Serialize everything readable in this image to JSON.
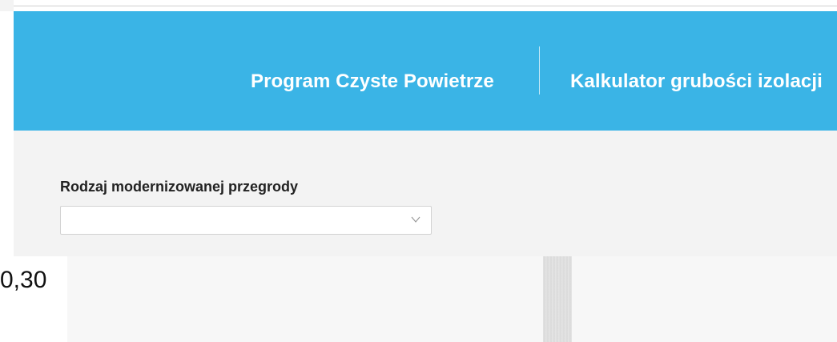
{
  "nav": {
    "links": [
      {
        "label": "Program Czyste Powietrze"
      },
      {
        "label": "Kalkulator grubości izolacji"
      }
    ]
  },
  "form": {
    "label": "Rodzaj modernizowanej przegrody",
    "select": {
      "value": "",
      "chevron_icon": "chevron-down-icon"
    }
  },
  "content": {
    "value_text": "0,30"
  },
  "colors": {
    "navbar_bg": "#3ab4e6",
    "panel_bg": "#f3f3f3",
    "text_dark": "#222222"
  }
}
